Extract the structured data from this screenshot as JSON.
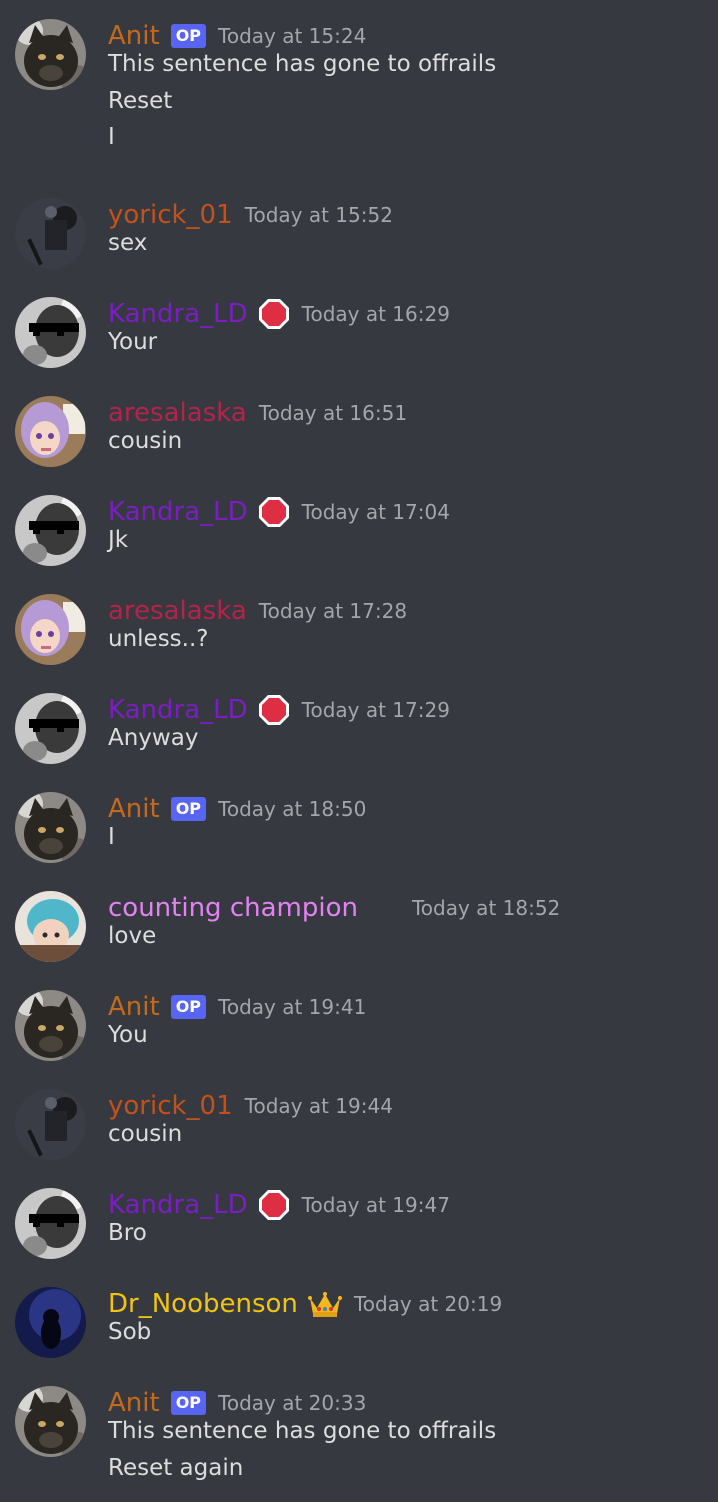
{
  "colors": {
    "background": "#36393f",
    "message_text": "#dcddde",
    "timestamp": "#a3a6aa",
    "op_badge": "#5865f2"
  },
  "users": {
    "anit": {
      "name": "Anit",
      "color": "#c26a1f"
    },
    "yorick": {
      "name": "yorick_01",
      "color": "#c2521a"
    },
    "kandra": {
      "name": "Kandra_LD",
      "color": "#7a1fbf"
    },
    "aresalaska": {
      "name": "aresalaska",
      "color": "#b3234c"
    },
    "counting": {
      "name": "counting champion",
      "color": "#e283f1"
    },
    "noobenson": {
      "name": "Dr_Noobenson",
      "color": "#f1c40f"
    }
  },
  "badges": {
    "op": "OP",
    "stop_icon": "stop-sign-icon",
    "crown_icon": "crown-icon"
  },
  "messages": [
    {
      "user": "anit",
      "badge": "op",
      "timestamp": "Today at 15:24",
      "lines": [
        "This sentence has gone to offrails",
        "Reset",
        "I"
      ]
    },
    {
      "user": "yorick",
      "badge": "",
      "timestamp": "Today at 15:52",
      "lines": [
        "sex"
      ]
    },
    {
      "user": "kandra",
      "badge": "stop",
      "timestamp": "Today at 16:29",
      "lines": [
        "Your"
      ]
    },
    {
      "user": "aresalaska",
      "badge": "",
      "timestamp": "Today at 16:51",
      "lines": [
        "cousin"
      ]
    },
    {
      "user": "kandra",
      "badge": "stop",
      "timestamp": "Today at 17:04",
      "lines": [
        "Jk"
      ]
    },
    {
      "user": "aresalaska",
      "badge": "",
      "timestamp": "Today at 17:28",
      "lines": [
        "unless..?"
      ]
    },
    {
      "user": "kandra",
      "badge": "stop",
      "timestamp": "Today at 17:29",
      "lines": [
        "Anyway"
      ]
    },
    {
      "user": "anit",
      "badge": "op",
      "timestamp": "Today at 18:50",
      "lines": [
        "I"
      ]
    },
    {
      "user": "counting",
      "badge": "",
      "timestamp": "Today at 18:52",
      "lines": [
        "love"
      ]
    },
    {
      "user": "anit",
      "badge": "op",
      "timestamp": "Today at 19:41",
      "lines": [
        "You"
      ]
    },
    {
      "user": "yorick",
      "badge": "",
      "timestamp": "Today at 19:44",
      "lines": [
        "cousin"
      ]
    },
    {
      "user": "kandra",
      "badge": "stop",
      "timestamp": "Today at 19:47",
      "lines": [
        "Bro"
      ]
    },
    {
      "user": "noobenson",
      "badge": "crown",
      "timestamp": "Today at 20:19",
      "lines": [
        "Sob"
      ]
    },
    {
      "user": "anit",
      "badge": "op",
      "timestamp": "Today at 20:33",
      "lines": [
        "This sentence has gone to offrails",
        "Reset again"
      ]
    }
  ]
}
